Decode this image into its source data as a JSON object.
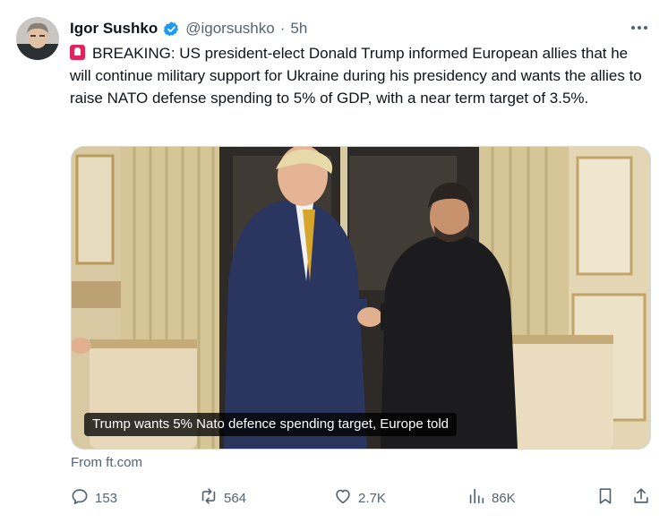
{
  "tweet": {
    "author_name": "Igor Sushko",
    "handle": "@igorsushko",
    "separator": "·",
    "time": "5h",
    "text": "BREAKING: US president-elect Donald Trump informed European allies that he will continue military support for Ukraine during his presidency and wants the allies to raise NATO defense spending to 5% of GDP, with a near term target of 3.5%.",
    "lead_emoji": "rotating-light-icon"
  },
  "card": {
    "caption": "Trump wants 5% Nato defence spending target, Europe told",
    "source": "From ft.com"
  },
  "actions": {
    "replies": "153",
    "reposts": "564",
    "likes": "2.7K",
    "views": "86K"
  },
  "colors": {
    "accent": "#1d9bf0",
    "muted": "#536471",
    "siren": "#e0245e"
  }
}
